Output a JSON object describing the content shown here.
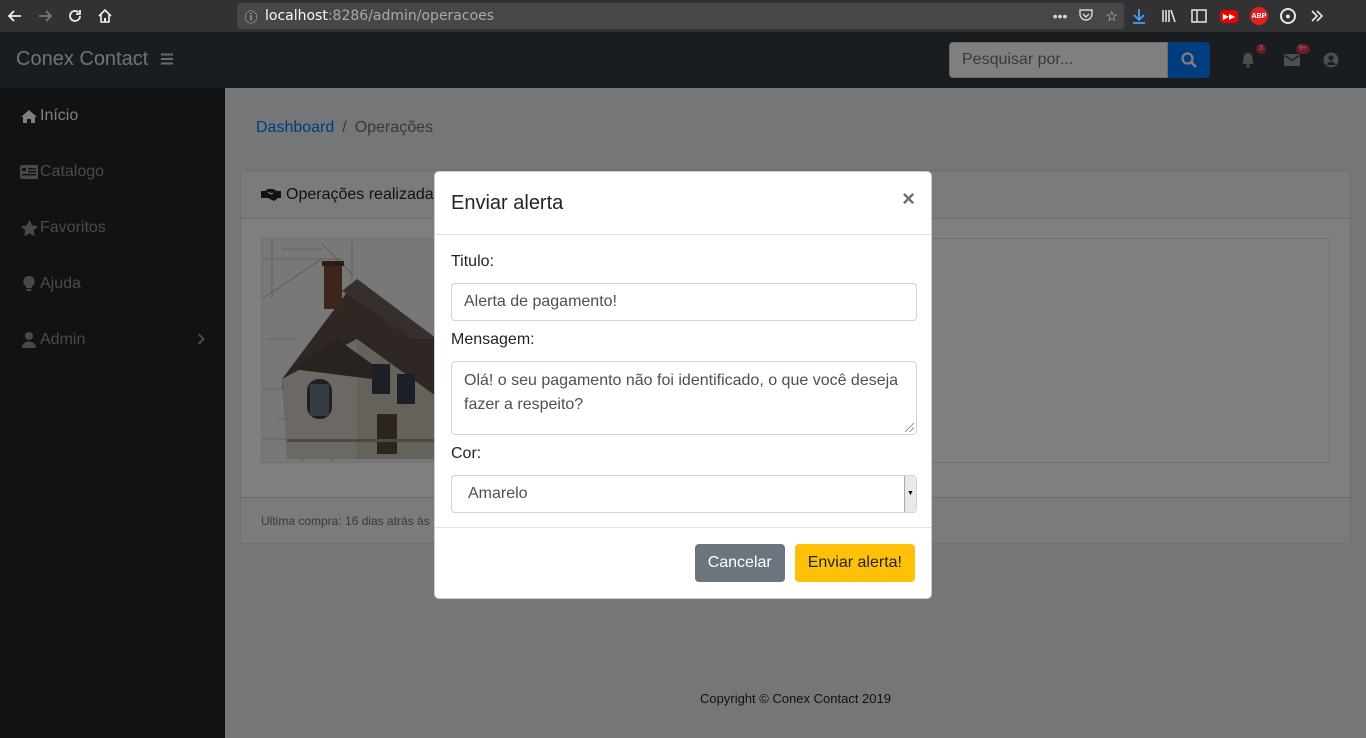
{
  "browser": {
    "url_host": "localhost",
    "url_rest": ":8286/admin/operacoes"
  },
  "app": {
    "brand": "Conex Contact",
    "search_placeholder": "Pesquisar por...",
    "notifications_badge": "3",
    "messages_badge": "9+"
  },
  "sidebar": {
    "items": [
      {
        "label": "Início",
        "icon": "home-icon"
      },
      {
        "label": "Catalogo",
        "icon": "list-icon"
      },
      {
        "label": "Favoritos",
        "icon": "star-icon"
      },
      {
        "label": "Ajuda",
        "icon": "lightbulb-icon"
      },
      {
        "label": "Admin",
        "icon": "user-icon"
      }
    ]
  },
  "breadcrumb": {
    "link": "Dashboard",
    "separator": "/",
    "current": "Operações"
  },
  "card": {
    "header": "Operações realizadas",
    "footer": "Ultima compra: 16 dias atrás às"
  },
  "footer": {
    "text": "Copyright © Conex Contact 2019"
  },
  "modal": {
    "title": "Enviar alerta",
    "close": "×",
    "title_label": "Titulo:",
    "title_value": "Alerta de pagamento!",
    "message_label": "Mensagem:",
    "message_value": "Olá! o seu pagamento não foi identificado, o que você deseja fazer a respeito?",
    "color_label": "Cor:",
    "color_value": "Amarelo",
    "cancel": "Cancelar",
    "submit": "Enviar alerta!"
  }
}
